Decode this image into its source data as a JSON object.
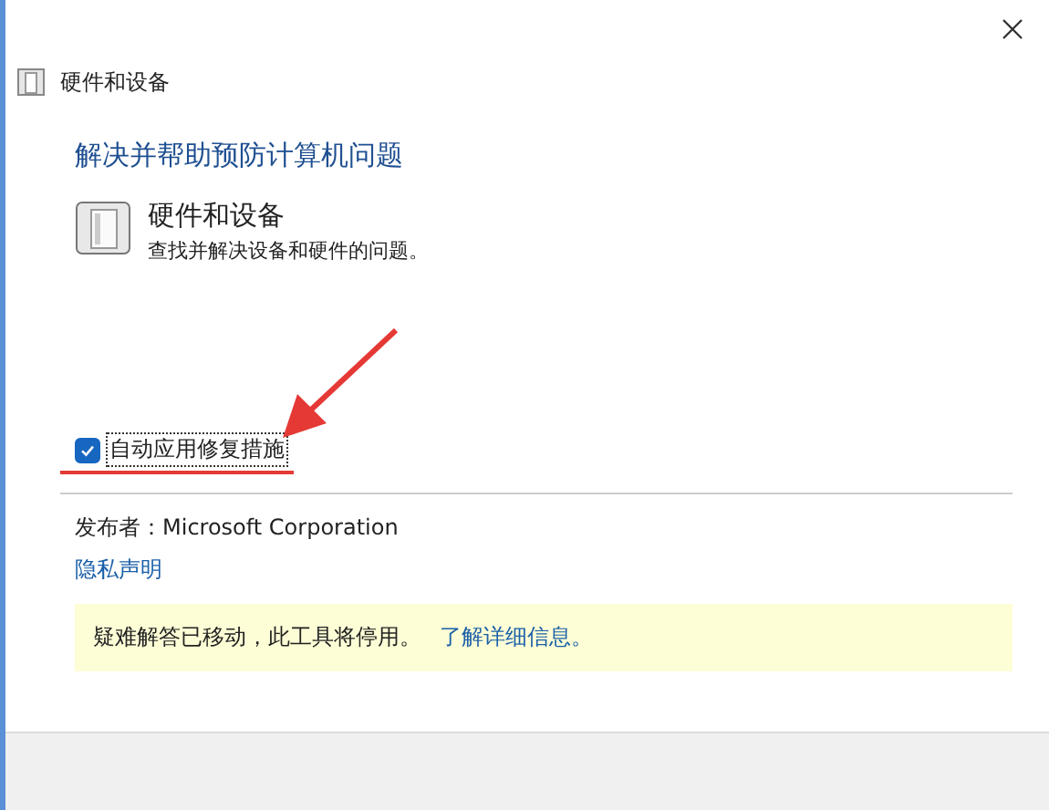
{
  "window": {
    "title": "硬件和设备"
  },
  "heading": "解决并帮助预防计算机问题",
  "troubleshooter": {
    "title": "硬件和设备",
    "description": "查找并解决设备和硬件的问题。"
  },
  "auto_fix": {
    "label": "自动应用修复措施",
    "checked": true
  },
  "publisher": "发布者：Microsoft Corporation",
  "privacy_link": "隐私声明",
  "notice": {
    "text": "疑难解答已移动，此工具将停用。",
    "link": "了解详细信息。"
  }
}
